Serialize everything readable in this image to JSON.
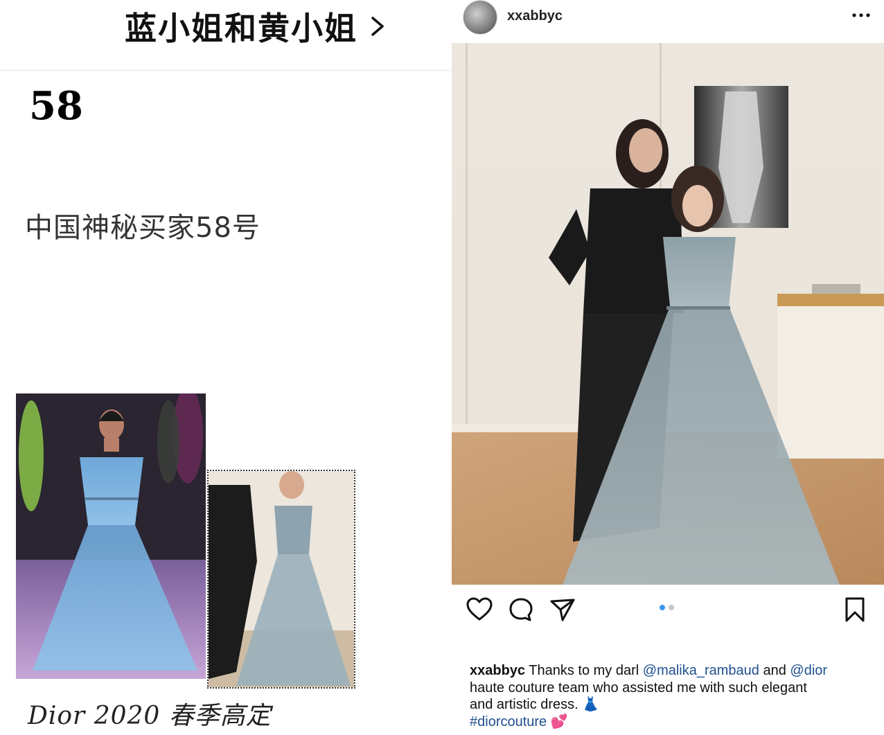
{
  "left": {
    "account_name": "蓝小姐和黄小姐",
    "number": "58",
    "subtitle": "中国神秘买家58号",
    "caption": "Dior 2020 春季高定"
  },
  "post": {
    "username": "xxabbyc",
    "caption_user": "xxabbyc",
    "caption_part1": " Thanks to my darl ",
    "mention1": "@malika_rambaud",
    "caption_part2": " and ",
    "mention2": "@dior",
    "caption_line2": "haute couture team who assisted me with such elegant",
    "caption_line3": "and artistic dress. ",
    "dress_emoji": "👗",
    "hashtag": "#diorcouture",
    "hearts_emoji": "💕",
    "carousel_pages": 2,
    "carousel_current": 1
  },
  "icons": {
    "like": "heart-icon",
    "comment": "comment-icon",
    "share": "paper-plane-icon",
    "save": "bookmark-icon",
    "more": "more-horizontal-icon",
    "chevron": "chevron-right-icon"
  },
  "colors": {
    "mention": "#1d4f8f",
    "active_dot": "#3897f0"
  }
}
